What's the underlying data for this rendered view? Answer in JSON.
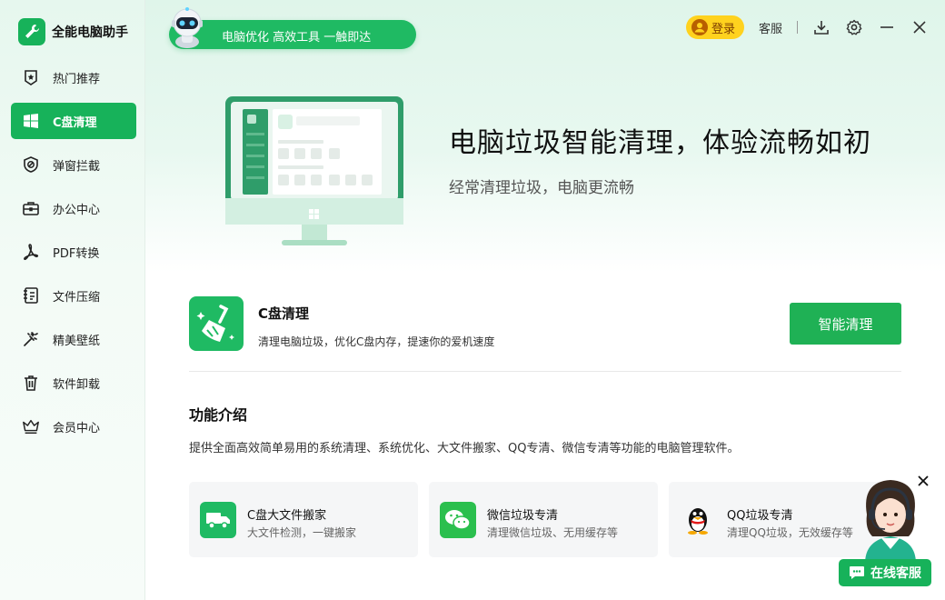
{
  "app": {
    "name": "全能电脑助手"
  },
  "sidebar": {
    "items": [
      {
        "label": "热门推荐",
        "icon": "star-badge-icon",
        "active": false
      },
      {
        "label": "C盘清理",
        "icon": "windows-icon",
        "active": true
      },
      {
        "label": "弹窗拦截",
        "icon": "block-shield-icon",
        "active": false
      },
      {
        "label": "办公中心",
        "icon": "briefcase-icon",
        "active": false
      },
      {
        "label": "PDF转换",
        "icon": "pdf-icon",
        "active": false
      },
      {
        "label": "文件压缩",
        "icon": "archive-icon",
        "active": false
      },
      {
        "label": "精美壁纸",
        "icon": "wallpaper-icon",
        "active": false
      },
      {
        "label": "软件卸载",
        "icon": "trash-icon",
        "active": false
      },
      {
        "label": "会员中心",
        "icon": "crown-icon",
        "active": false
      }
    ]
  },
  "banner": {
    "text": "电脑优化 高效工具 一触即达"
  },
  "topbar": {
    "login": "登录",
    "service": "客服"
  },
  "hero": {
    "title": "电脑垃圾智能清理，体验流畅如初",
    "subtitle": "经常清理垃圾，电脑更流畅"
  },
  "feature": {
    "title": "C盘清理",
    "desc": "清理电脑垃圾，优化C盘内存，提速你的爱机速度",
    "button": "智能清理"
  },
  "intro": {
    "title": "功能介绍",
    "desc": "提供全面高效简单易用的系统清理、系统优化、大文件搬家、QQ专清、微信专清等功能的电脑管理软件。"
  },
  "tools": [
    {
      "title": "C盘大文件搬家",
      "desc": "大文件检测，一键搬家",
      "icon": "truck-icon",
      "color": "#1fba63"
    },
    {
      "title": "微信垃圾专清",
      "desc": "清理微信垃圾、无用缓存等",
      "icon": "wechat-icon",
      "color": "#2bbf4e"
    },
    {
      "title": "QQ垃圾专清",
      "desc": "清理QQ垃圾，无效缓存等",
      "icon": "qq-penguin-icon",
      "color": "#f5f6f7"
    }
  ],
  "customer_service": {
    "label": "在线客服"
  },
  "colors": {
    "accent": "#17b25a",
    "login": "#ffd21e"
  }
}
